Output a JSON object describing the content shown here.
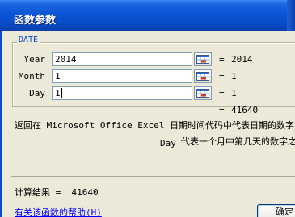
{
  "dialog": {
    "title": "函数参数",
    "function_name": "DATE"
  },
  "params": [
    {
      "label": "Year",
      "value": "2014",
      "result": "2014"
    },
    {
      "label": "Month",
      "value": "1",
      "result": "1"
    },
    {
      "label": "Day",
      "value": "1",
      "result": "1"
    }
  ],
  "formula_result": "41640",
  "eq_sign": "=",
  "description": "返回在 Microsoft Office Excel 日期时间代码中代表日期的数字",
  "current_param": {
    "name": "Day",
    "help": "代表一个月中第几天的数字之间"
  },
  "calc_result_text": "计算结果 =  41640",
  "help_link": "有关该函数的帮助(H)",
  "buttons": {
    "ok": "确定"
  },
  "colors": {
    "title_bar": "#0a55d6",
    "group_label": "#0046d5",
    "link": "#0000ff",
    "dialog_bg": "#ece9d8"
  }
}
